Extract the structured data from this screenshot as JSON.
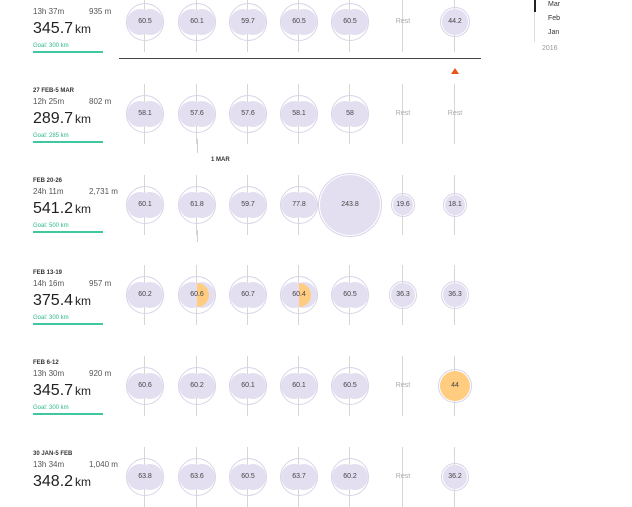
{
  "weeks": [
    {
      "label": "",
      "time": "13h 37m",
      "elevation": "935 m",
      "distance": "345.7",
      "unit": "km",
      "goal": "Goal: 300 km",
      "days": [
        "60.5",
        "60.1",
        "59.7",
        "60.5",
        "60.5",
        "Rest",
        "44.2"
      ]
    },
    {
      "label": "27 FEB-5 MAR",
      "time": "12h 25m",
      "elevation": "802 m",
      "distance": "289.7",
      "unit": "km",
      "goal": "Goal: 285 km",
      "days": [
        "58.1",
        "57.6",
        "57.6",
        "58.1",
        "58",
        "Rest",
        "Rest"
      ]
    },
    {
      "label": "FEB 20-26",
      "time": "24h 11m",
      "elevation": "2,731 m",
      "distance": "541.2",
      "unit": "km",
      "goal": "Goal: 500 km",
      "days": [
        "60.1",
        "61.8",
        "59.7",
        "77.8",
        "243.8",
        "19.6",
        "18.1"
      ]
    },
    {
      "label": "FEB 13-19",
      "time": "14h 16m",
      "elevation": "957 m",
      "distance": "375.4",
      "unit": "km",
      "goal": "Goal: 300 km",
      "days": [
        "60.2",
        "60.6",
        "60.7",
        "60.4",
        "60.5",
        "36.3",
        "36.3"
      ]
    },
    {
      "label": "FEB 6-12",
      "time": "13h 30m",
      "elevation": "920 m",
      "distance": "345.7",
      "unit": "km",
      "goal": "Goal: 300 km",
      "days": [
        "60.6",
        "60.2",
        "60.1",
        "60.1",
        "60.5",
        "Rest",
        "44"
      ]
    },
    {
      "label": "30 JAN-5 FEB",
      "time": "13h 34m",
      "elevation": "1,040 m",
      "distance": "348.2",
      "unit": "km",
      "goal": "",
      "days": [
        "63.8",
        "63.6",
        "60.5",
        "63.7",
        "60.2",
        "Rest",
        "36.2"
      ]
    }
  ],
  "month_marker": "1 MAR",
  "timeline": {
    "months": [
      "Mar",
      "Feb",
      "Jan"
    ],
    "year": "2016",
    "selected": "Mar"
  },
  "colors": {
    "bubble": "#e3dff0",
    "highlight": "#ffcc80",
    "goal": "#3fc8a0",
    "marker": "#e8541c"
  }
}
